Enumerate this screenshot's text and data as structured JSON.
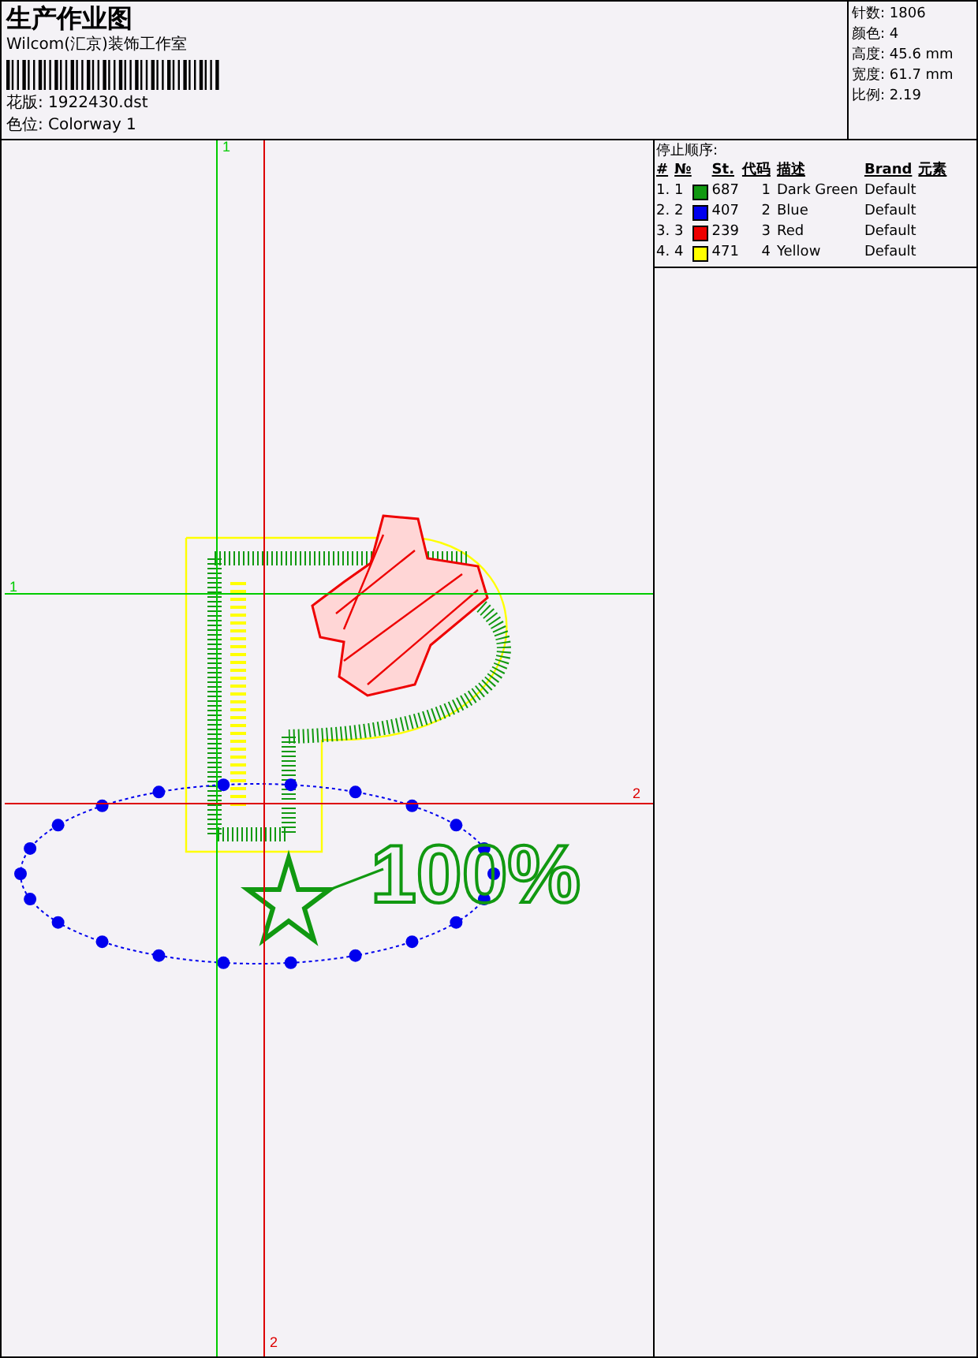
{
  "header": {
    "title": "生产作业图",
    "company": "Wilcom(汇京)装饰工作室",
    "design_file": "花版: 1922430.dst",
    "colorway": "色位: Colorway 1"
  },
  "stats": [
    "针数: 1806",
    "颜色: 4",
    "高度: 45.6 mm",
    "宽度: 61.7 mm",
    "比例: 2.19"
  ],
  "stop_sequence": {
    "title": "停止顺序:",
    "columns": [
      "#",
      "№",
      "St.",
      "代码",
      "描述",
      "Brand",
      "元素"
    ],
    "rows": [
      {
        "index": "1.",
        "number": "1",
        "color": "#119911",
        "stitches": "687",
        "code": "1",
        "description": "Dark Green",
        "brand": "Default"
      },
      {
        "index": "2.",
        "number": "2",
        "color": "#0000ee",
        "stitches": "407",
        "code": "2",
        "description": "Blue",
        "brand": "Default"
      },
      {
        "index": "3.",
        "number": "3",
        "color": "#ee0000",
        "stitches": "239",
        "code": "3",
        "description": "Red",
        "brand": "Default"
      },
      {
        "index": "4.",
        "number": "4",
        "color": "#ffff00",
        "stitches": "471",
        "code": "4",
        "description": "Yellow",
        "brand": "Default"
      }
    ]
  },
  "canvas": {
    "guides": [
      {
        "label": "1",
        "kind": "vertical",
        "color": "#00cc00"
      },
      {
        "label": "1",
        "kind": "horizontal",
        "color": "#00cc00"
      },
      {
        "label": "2",
        "kind": "horizontal",
        "color": "#dd0000"
      },
      {
        "label": "2",
        "kind": "vertical",
        "color": "#dd0000"
      }
    ],
    "design_text": "100%"
  }
}
